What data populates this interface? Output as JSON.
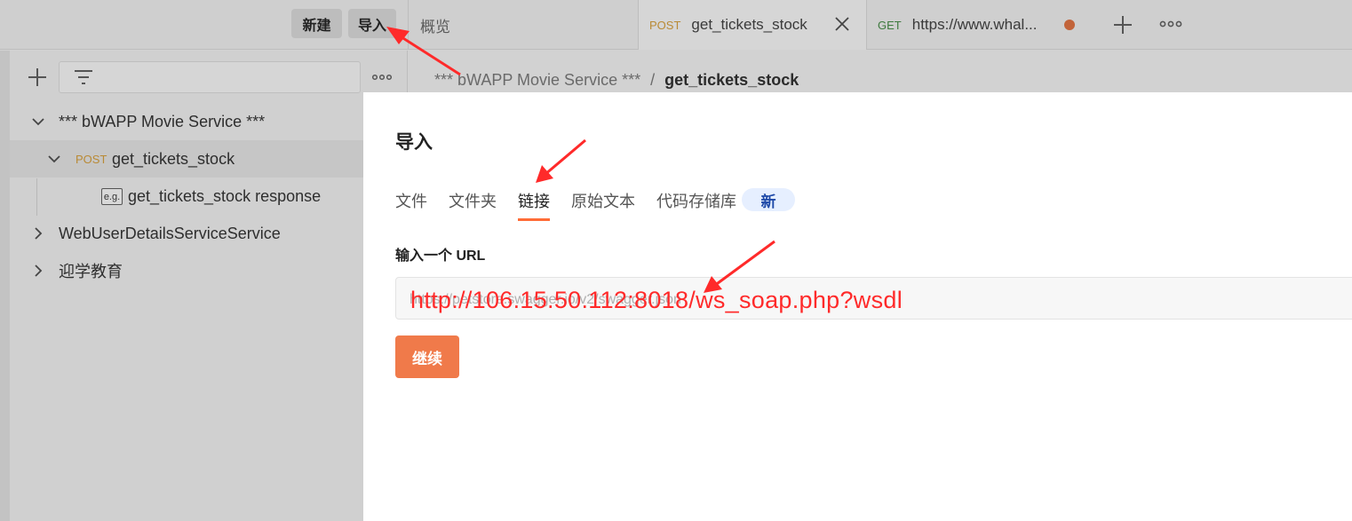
{
  "topbar": {
    "new_label": "新建",
    "import_label": "导入",
    "tabs": [
      {
        "label": "概览"
      },
      {
        "method": "POST",
        "label": "get_tickets_stock"
      },
      {
        "method": "GET",
        "label": "https://www.whal..."
      }
    ]
  },
  "sidebar": {
    "tree": [
      {
        "label": "*** bWAPP Movie Service ***"
      },
      {
        "method": "POST",
        "label": "get_tickets_stock"
      },
      {
        "icon_text": "e.g.",
        "label": "get_tickets_stock response"
      },
      {
        "label": "WebUserDetailsServiceService"
      },
      {
        "label": "迎学教育"
      }
    ]
  },
  "breadcrumb": {
    "parent": "*** bWAPP Movie Service ***",
    "separator": "/",
    "current": "get_tickets_stock"
  },
  "modal": {
    "title": "导入",
    "tabs": [
      "文件",
      "文件夹",
      "链接",
      "原始文本",
      "代码存储库"
    ],
    "active_tab": "链接",
    "new_badge": "新",
    "url_label": "输入一个 URL",
    "url_placeholder": "https://petstore.swagger.io/v2/swagger.json",
    "url_value": "http://106.15.50.112:8018/ws_soap.php?wsdl",
    "continue_label": "继续"
  },
  "colors": {
    "accent": "#ff6c37",
    "button": "#f07a4a",
    "annotation": "#ff2a2a",
    "badge_bg": "#e6efff",
    "badge_text": "#1f4aa8"
  }
}
